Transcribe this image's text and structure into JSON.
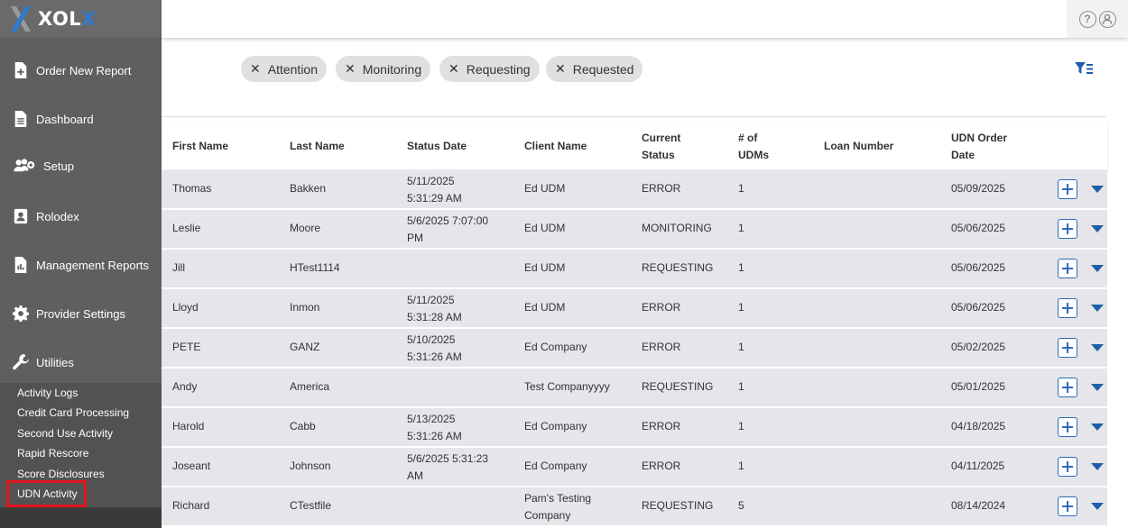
{
  "app": {
    "logo_text_1": "X",
    "logo_text_2": "OL",
    "logo_text_3": "X"
  },
  "sidebar": {
    "items": [
      {
        "label": "Order New Report",
        "icon": "file-plus-icon"
      },
      {
        "label": "Dashboard",
        "icon": "document-icon"
      },
      {
        "label": "Setup",
        "icon": "users-gear-icon"
      },
      {
        "label": "Rolodex",
        "icon": "contact-card-icon"
      },
      {
        "label": "Management Reports",
        "icon": "report-chart-icon"
      },
      {
        "label": "Provider Settings",
        "icon": "gear-icon"
      },
      {
        "label": "Utilities",
        "icon": "wrench-icon"
      }
    ],
    "utilities": [
      {
        "label": "Activity Logs"
      },
      {
        "label": "Credit Card Processing"
      },
      {
        "label": "Second Use Activity"
      },
      {
        "label": "Rapid Rescore"
      },
      {
        "label": "Score Disclosures"
      },
      {
        "label": "UDN Activity"
      }
    ]
  },
  "filters": [
    "Attention",
    "Monitoring",
    "Requesting",
    "Requested"
  ],
  "table": {
    "headers": {
      "first_name": "First Name",
      "last_name": "Last Name",
      "status_date": "Status Date",
      "client_name": "Client Name",
      "current_status_1": "Current",
      "current_status_2": "Status",
      "num_udms_1": "# of",
      "num_udms_2": "UDMs",
      "loan_number": "Loan Number",
      "udn_order_date_1": "UDN Order",
      "udn_order_date_2": "Date"
    },
    "rows": [
      {
        "first": "Thomas",
        "last": "Bakken",
        "date1": "5/11/2025",
        "date2": "5:31:29 AM",
        "client1": "Ed UDM",
        "client2": "",
        "status": "ERROR",
        "udms": "1",
        "loan": "",
        "order": "05/09/2025"
      },
      {
        "first": "Leslie",
        "last": "Moore",
        "date1": "5/6/2025 7:07:00",
        "date2": "PM",
        "client1": "Ed UDM",
        "client2": "",
        "status": "MONITORING",
        "udms": "1",
        "loan": "",
        "order": "05/06/2025"
      },
      {
        "first": "Jill",
        "last": "HTest1114",
        "date1": "",
        "date2": "",
        "client1": "Ed UDM",
        "client2": "",
        "status": "REQUESTING",
        "udms": "1",
        "loan": "",
        "order": "05/06/2025"
      },
      {
        "first": "Lloyd",
        "last": "Inmon",
        "date1": "5/11/2025",
        "date2": "5:31:28 AM",
        "client1": "Ed UDM",
        "client2": "",
        "status": "ERROR",
        "udms": "1",
        "loan": "",
        "order": "05/06/2025"
      },
      {
        "first": "PETE",
        "last": "GANZ",
        "date1": "5/10/2025",
        "date2": "5:31:26 AM",
        "client1": "Ed Company",
        "client2": "",
        "status": "ERROR",
        "udms": "1",
        "loan": "",
        "order": "05/02/2025"
      },
      {
        "first": "Andy",
        "last": "America",
        "date1": "",
        "date2": "",
        "client1": "Test Companyyyy",
        "client2": "",
        "status": "REQUESTING",
        "udms": "1",
        "loan": "",
        "order": "05/01/2025"
      },
      {
        "first": "Harold",
        "last": "Cabb",
        "date1": "5/13/2025",
        "date2": "5:31:26 AM",
        "client1": "Ed Company",
        "client2": "",
        "status": "ERROR",
        "udms": "1",
        "loan": "",
        "order": "04/18/2025"
      },
      {
        "first": "Joseant",
        "last": "Johnson",
        "date1": "5/6/2025 5:31:23",
        "date2": "AM",
        "client1": "Ed Company",
        "client2": "",
        "status": "ERROR",
        "udms": "1",
        "loan": "",
        "order": "04/11/2025"
      },
      {
        "first": "Richard",
        "last": "CTestfile",
        "date1": "",
        "date2": "",
        "client1": "Pam's Testing",
        "client2": "Company",
        "status": "REQUESTING",
        "udms": "5",
        "loan": "",
        "order": "08/14/2024"
      }
    ]
  },
  "colors": {
    "accent": "#2d6cb5",
    "sidebar": "#5f5f5f",
    "highlight": "#e0141e"
  }
}
